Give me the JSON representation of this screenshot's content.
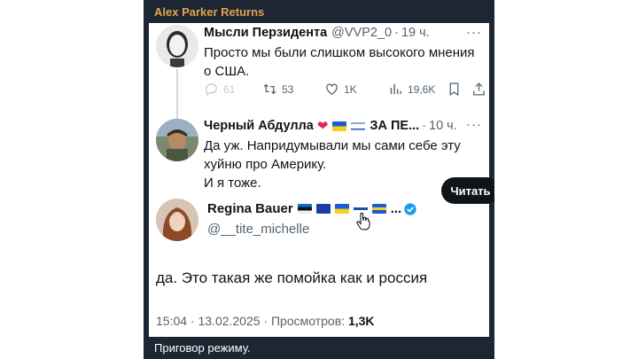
{
  "post": {
    "author": "Alex Parker Returns",
    "caption": "Приговор режиму.",
    "colors": {
      "background": "#1c2733",
      "author": "#e8a24e"
    }
  },
  "tweet1": {
    "name": "Мысли Перзидента",
    "handle": "@VVP2_0",
    "dot": "·",
    "time": "19 ч.",
    "more": "···",
    "text_line1": "Просто мы были слишком высокого мнения",
    "text_line2": "о США.",
    "actions": {
      "replies": "61",
      "retweets": "53",
      "likes": "1K",
      "views": "19,6K"
    }
  },
  "tweet2": {
    "name": "Черный Абдулла",
    "name_suffix": "ЗА ПЕ...",
    "dot": "·",
    "time": "10 ч.",
    "more": "···",
    "text_line1": "Да уж. Напридумывали мы сами себе  эту",
    "text_line2": "хуйню про Америку.",
    "text_line3": "И я тоже."
  },
  "tweet3": {
    "name": "Regina Bauer",
    "flags_trail": "...",
    "handle": "@__tite_michelle",
    "follow_label": "Читать",
    "text": "да. Это такая же помойка как и россия",
    "timestamp": "15:04 · 13.02.2025 · Просмотров:",
    "views": "1,3K"
  }
}
